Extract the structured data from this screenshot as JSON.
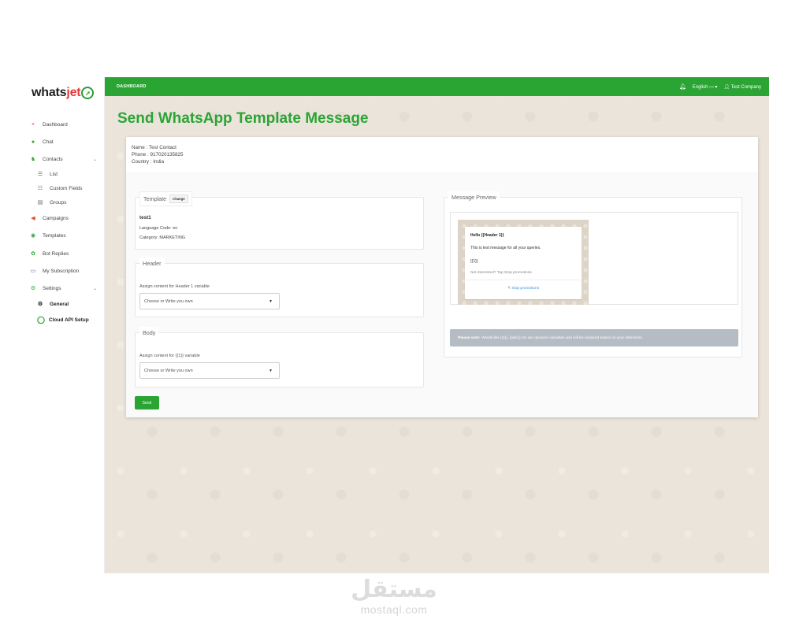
{
  "brand": {
    "name_part1": "whats",
    "name_part2": "jet",
    "accent": "#2aa534"
  },
  "sidebar": {
    "items": [
      {
        "label": "Dashboard",
        "icon": "gauge-icon"
      },
      {
        "label": "Chat",
        "icon": "chat-icon"
      },
      {
        "label": "Contacts",
        "icon": "users-icon"
      },
      {
        "label": "List",
        "icon": "list-icon"
      },
      {
        "label": "Custom Fields",
        "icon": "fields-icon"
      },
      {
        "label": "Groups",
        "icon": "groups-icon"
      },
      {
        "label": "Campaigns",
        "icon": "megaphone-icon"
      },
      {
        "label": "Templates",
        "icon": "template-icon"
      },
      {
        "label": "Bot Replies",
        "icon": "bot-icon"
      },
      {
        "label": "My Subscription",
        "icon": "card-icon"
      },
      {
        "label": "Settings",
        "icon": "gears-icon"
      },
      {
        "label": "General",
        "icon": "gear-icon"
      },
      {
        "label": "Cloud API Setup",
        "icon": "whatsapp-icon"
      }
    ]
  },
  "topbar": {
    "breadcrumb": "DASHBOARD",
    "language": "English",
    "user": "Test Company"
  },
  "page": {
    "title": "Send WhatsApp Template Message"
  },
  "contact": {
    "name": "Name : Test Contact",
    "phone": "Phone : 917020135825",
    "country": "Country : India"
  },
  "template_box": {
    "legend": "Template",
    "change_label": "Change",
    "name": "test1",
    "language": "Language Code: en",
    "category": "Category: MARKETING"
  },
  "header_box": {
    "legend": "Header",
    "label": "Assign content for Header 1 variable",
    "select_value": "Choose or Write you own"
  },
  "body_box": {
    "legend": "Body",
    "label": "Assign content for {{1}} variable",
    "select_value": "Choose or Write you own"
  },
  "send_label": "Send",
  "preview": {
    "legend": "Message Preview",
    "header": "Hello {{Header 1}}",
    "body": "This is test message for all your queries.",
    "var": "{{1}}",
    "footer": "Not interested? Tap Stop promotions",
    "button": "Stop promotions",
    "note_bold": "Please note:",
    "note_text": "Words like {{1}}, {{abc}} etc are dynamic variables and will be replaced based on your selections."
  },
  "watermark": {
    "arabic": "مستقل",
    "latin": "mostaql.com"
  }
}
